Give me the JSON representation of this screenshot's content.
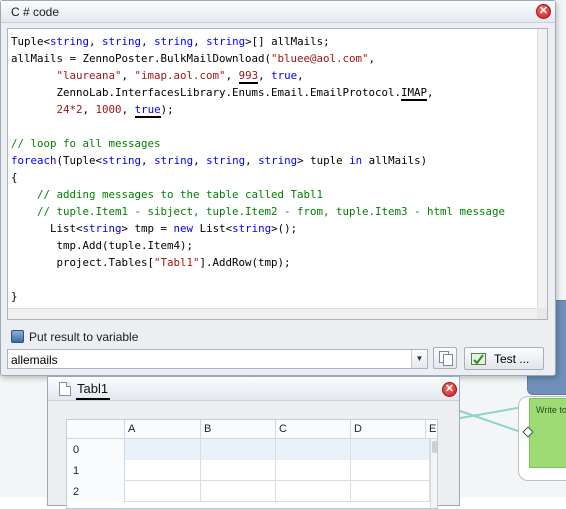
{
  "dialog": {
    "title": "C # code",
    "close_glyph": "✕",
    "code_lines": [
      [
        {
          "t": "Tuple<",
          "c": "plain"
        },
        {
          "t": "string",
          "c": "kw"
        },
        {
          "t": ", ",
          "c": "plain"
        },
        {
          "t": "string",
          "c": "kw"
        },
        {
          "t": ", ",
          "c": "plain"
        },
        {
          "t": "string",
          "c": "kw"
        },
        {
          "t": ", ",
          "c": "plain"
        },
        {
          "t": "string",
          "c": "kw"
        },
        {
          "t": ">[] allMails;",
          "c": "plain"
        }
      ],
      [
        {
          "t": "allMails = ZennoPoster.BulkMailDownload(",
          "c": "plain"
        },
        {
          "t": "\"bluee@aol.com\"",
          "c": "str"
        },
        {
          "t": ",",
          "c": "plain"
        }
      ],
      [
        {
          "t": "       ",
          "c": "plain"
        },
        {
          "t": "\"laureana\"",
          "c": "str"
        },
        {
          "t": ", ",
          "c": "plain"
        },
        {
          "t": "\"imap.aol.com\"",
          "c": "str"
        },
        {
          "t": ", ",
          "c": "plain"
        },
        {
          "t": "993",
          "c": "str",
          "u": true
        },
        {
          "t": ", ",
          "c": "plain"
        },
        {
          "t": "true",
          "c": "kw"
        },
        {
          "t": ",",
          "c": "plain"
        }
      ],
      [
        {
          "t": "       ZennoLab.InterfacesLibrary.Enums.Email.EmailProtocol.",
          "c": "plain"
        },
        {
          "t": "IMAP",
          "c": "plain",
          "u": true
        },
        {
          "t": ",",
          "c": "plain"
        }
      ],
      [
        {
          "t": "       ",
          "c": "plain"
        },
        {
          "t": "24*2",
          "c": "str"
        },
        {
          "t": ", ",
          "c": "plain"
        },
        {
          "t": "1000",
          "c": "str"
        },
        {
          "t": ", ",
          "c": "plain"
        },
        {
          "t": "true",
          "c": "kw",
          "u": true
        },
        {
          "t": ");",
          "c": "plain"
        }
      ],
      [
        {
          "t": "",
          "c": "plain"
        }
      ],
      [
        {
          "t": "// loop fo all messages",
          "c": "com"
        }
      ],
      [
        {
          "t": "foreach",
          "c": "kw"
        },
        {
          "t": "(Tuple<",
          "c": "plain"
        },
        {
          "t": "string",
          "c": "kw"
        },
        {
          "t": ", ",
          "c": "plain"
        },
        {
          "t": "string",
          "c": "kw"
        },
        {
          "t": ", ",
          "c": "plain"
        },
        {
          "t": "string",
          "c": "kw"
        },
        {
          "t": ", ",
          "c": "plain"
        },
        {
          "t": "string",
          "c": "kw"
        },
        {
          "t": "> tuple ",
          "c": "plain"
        },
        {
          "t": "in",
          "c": "kw"
        },
        {
          "t": " allMails)",
          "c": "plain"
        }
      ],
      [
        {
          "t": "{",
          "c": "plain"
        }
      ],
      [
        {
          "t": "    // adding messages to the table called Tabl1",
          "c": "com"
        }
      ],
      [
        {
          "t": "    // tuple.Item1 - sibject, tuple.Item2 - from, tuple.Item3 - html message",
          "c": "com"
        }
      ],
      [
        {
          "t": "      List<",
          "c": "plain"
        },
        {
          "t": "string",
          "c": "kw"
        },
        {
          "t": "> tmp = ",
          "c": "plain"
        },
        {
          "t": "new",
          "c": "kw"
        },
        {
          "t": " List<",
          "c": "plain"
        },
        {
          "t": "string",
          "c": "kw"
        },
        {
          "t": ">();",
          "c": "plain"
        }
      ],
      [
        {
          "t": "       tmp.Add(tuple.Item4);",
          "c": "plain"
        }
      ],
      [
        {
          "t": "       project.Tables[",
          "c": "plain"
        },
        {
          "t": "\"Tabl1\"",
          "c": "str"
        },
        {
          "t": "].AddRow(tmp);",
          "c": "plain"
        }
      ],
      [
        {
          "t": "",
          "c": "plain"
        }
      ],
      [
        {
          "t": "}",
          "c": "plain"
        }
      ]
    ],
    "put_result_label": "Put result to variable",
    "variable_value": "allemails",
    "dropdown_glyph": "▼",
    "test_label": "Test ..."
  },
  "table_window": {
    "title": "Tabl1",
    "close_glyph": "✕",
    "columns": [
      "A",
      "B",
      "C",
      "D",
      "E"
    ],
    "rows": [
      "0",
      "1",
      "2"
    ]
  },
  "background": {
    "green_block_label": "Write to"
  },
  "colors": {
    "keyword": "#0000ff",
    "string": "#a31515",
    "comment": "#008000",
    "close_button": "#c81f1f"
  },
  "icons": {
    "put_result": "variable-icon",
    "copy": "copy-icon",
    "test": "test-icon",
    "table": "document-icon"
  }
}
